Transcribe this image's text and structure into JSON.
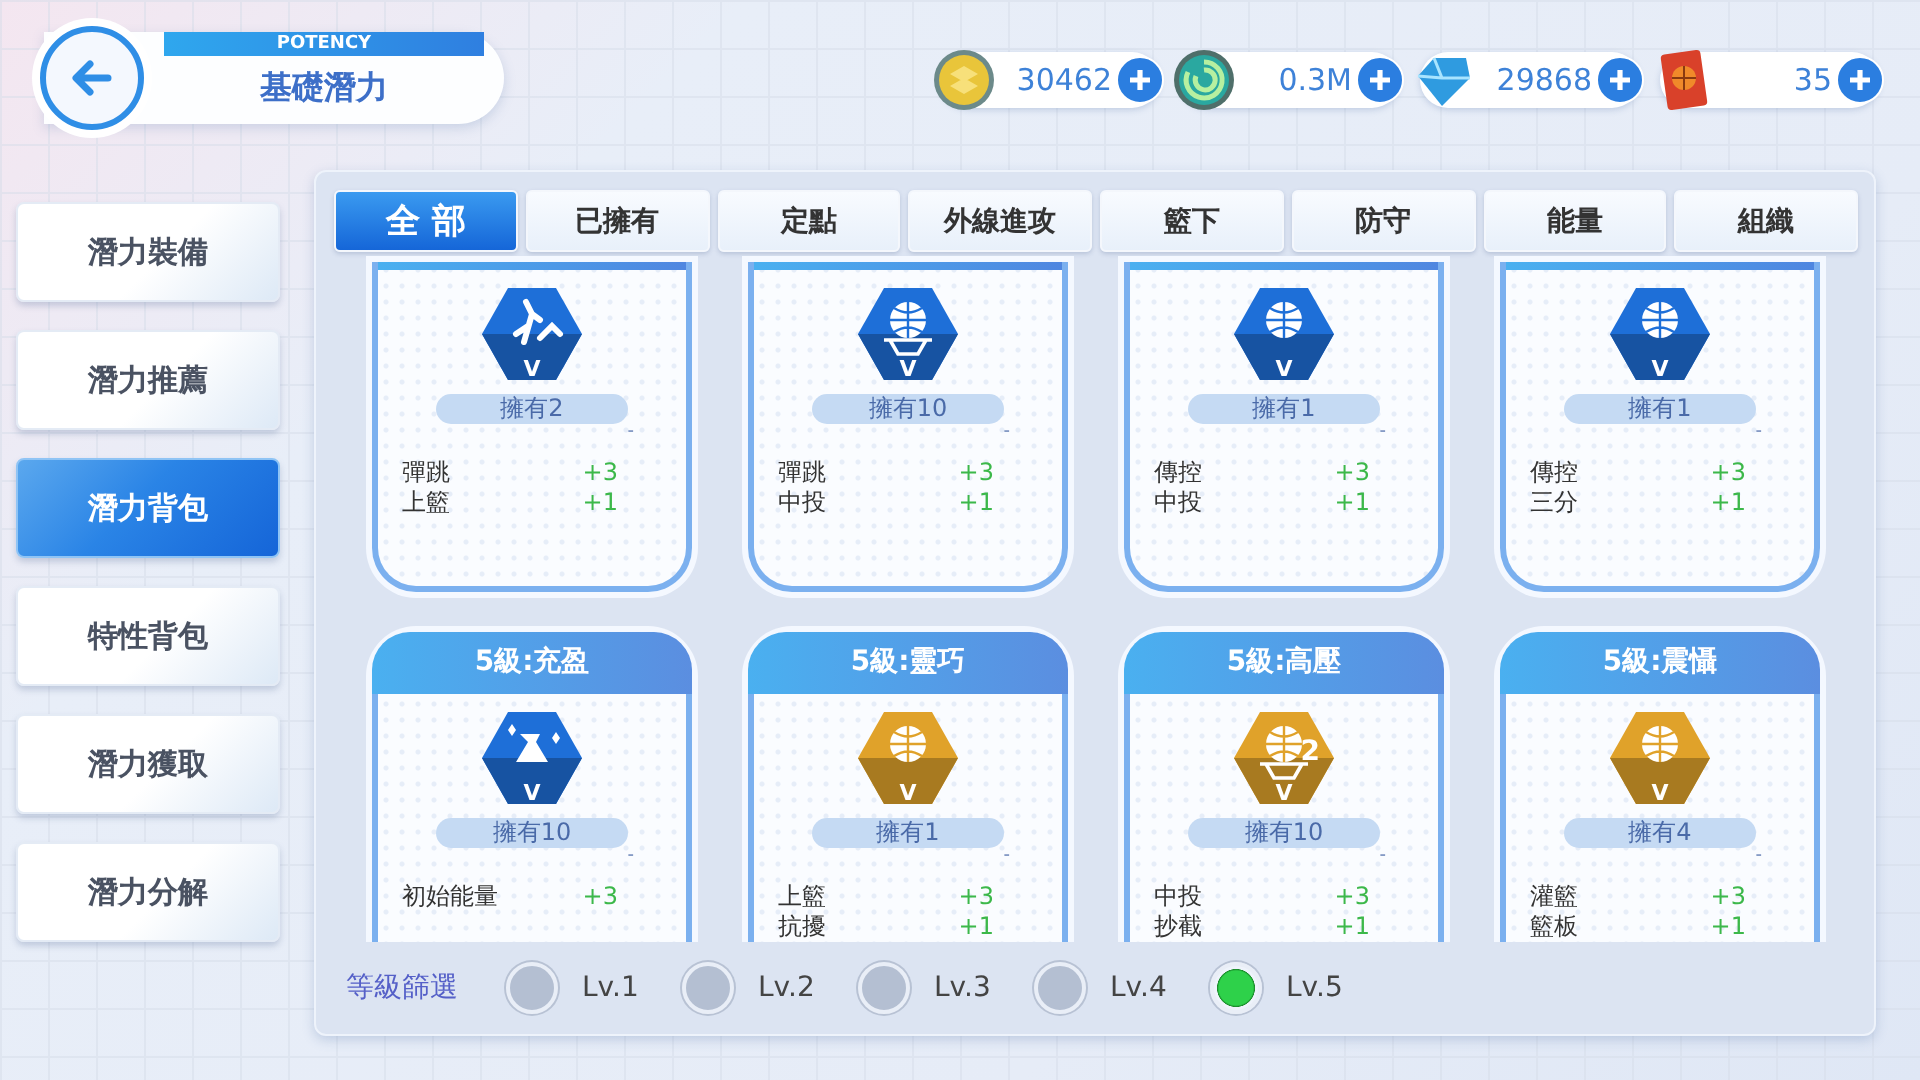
{
  "header": {
    "subtitle": "POTENCY",
    "title": "基礎潛力"
  },
  "currencies": [
    {
      "kind": "coin",
      "value": "30462"
    },
    {
      "kind": "swirl",
      "value": "0.3M"
    },
    {
      "kind": "gem",
      "value": "29868"
    },
    {
      "kind": "card",
      "value": "35"
    }
  ],
  "sidebar": {
    "items": [
      {
        "label": "潛力裝備",
        "selected": false
      },
      {
        "label": "潛力推薦",
        "selected": false
      },
      {
        "label": "潛力背包",
        "selected": true
      },
      {
        "label": "特性背包",
        "selected": false
      },
      {
        "label": "潛力獲取",
        "selected": false
      },
      {
        "label": "潛力分解",
        "selected": false
      }
    ]
  },
  "tabs": [
    {
      "label": "全 部",
      "selected": true
    },
    {
      "label": "已擁有",
      "selected": false
    },
    {
      "label": "定點",
      "selected": false
    },
    {
      "label": "外線進攻",
      "selected": false
    },
    {
      "label": "籃下",
      "selected": false
    },
    {
      "label": "防守",
      "selected": false
    },
    {
      "label": "能量",
      "selected": false
    },
    {
      "label": "組織",
      "selected": false
    }
  ],
  "cards": [
    {
      "kind": "jump",
      "color": "#1e6fd8",
      "grade": "V",
      "owned": "擁有2",
      "note": "-",
      "stats": [
        {
          "name": "彈跳",
          "value": "+3"
        },
        {
          "name": "上籃",
          "value": "+1"
        }
      ]
    },
    {
      "kind": "hoop",
      "color": "#1e6fd8",
      "grade": "V",
      "owned": "擁有10",
      "note": "-",
      "stats": [
        {
          "name": "彈跳",
          "value": "+3"
        },
        {
          "name": "中投",
          "value": "+1"
        }
      ]
    },
    {
      "kind": "ball",
      "color": "#1e6fd8",
      "grade": "V",
      "owned": "擁有1",
      "note": "-",
      "stats": [
        {
          "name": "傳控",
          "value": "+3"
        },
        {
          "name": "中投",
          "value": "+1"
        }
      ]
    },
    {
      "kind": "ball",
      "color": "#1e6fd8",
      "grade": "V",
      "owned": "擁有1",
      "note": "-",
      "stats": [
        {
          "name": "傳控",
          "value": "+3"
        },
        {
          "name": "三分",
          "value": "+1"
        }
      ]
    },
    {
      "title": "5級:充盈",
      "kind": "jug",
      "color": "#1e6fd8",
      "grade": "V",
      "owned": "擁有10",
      "note": "-",
      "stats": [
        {
          "name": "初始能量",
          "value": "+3"
        }
      ]
    },
    {
      "title": "5級:靈巧",
      "kind": "ball",
      "color": "#e0a22a",
      "grade": "V",
      "owned": "擁有1",
      "note": "-",
      "stats": [
        {
          "name": "上籃",
          "value": "+3"
        },
        {
          "name": "抗擾",
          "value": "+1"
        }
      ]
    },
    {
      "title": "5級:高壓",
      "kind": "hoop",
      "color": "#e0a22a",
      "grade": "V",
      "badge": "2",
      "owned": "擁有10",
      "note": "-",
      "stats": [
        {
          "name": "中投",
          "value": "+3"
        },
        {
          "name": "抄截",
          "value": "+1"
        }
      ]
    },
    {
      "title": "5級:震懾",
      "kind": "ball",
      "color": "#e0a22a",
      "grade": "V",
      "owned": "擁有4",
      "note": "-",
      "stats": [
        {
          "name": "灌籃",
          "value": "+3"
        },
        {
          "name": "籃板",
          "value": "+1"
        }
      ]
    }
  ],
  "level_filter": {
    "label": "等級篩選",
    "options": [
      {
        "label": "Lv.1",
        "selected": false
      },
      {
        "label": "Lv.2",
        "selected": false
      },
      {
        "label": "Lv.3",
        "selected": false
      },
      {
        "label": "Lv.4",
        "selected": false
      },
      {
        "label": "Lv.5",
        "selected": true
      }
    ]
  }
}
